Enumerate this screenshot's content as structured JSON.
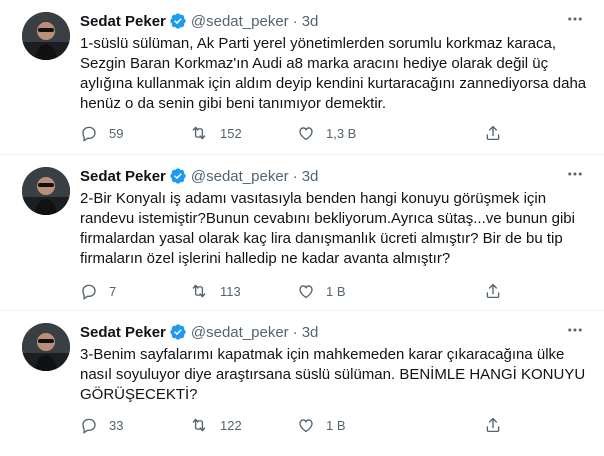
{
  "tweets": [
    {
      "name": "Sedat Peker",
      "handle": "@sedat_peker",
      "separator": "·",
      "time": "3d",
      "text": "1-süslü sülüman, Ak Parti yerel yönetimlerden sorumlu korkmaz karaca,\nSezgin Baran Korkmaz'ın Audi a8 marka aracını hediye olarak değil üç\naylığına kullanmak için aldım deyip kendini kurtaracağını zannediyorsa daha\nhenüz o da senin gibi beni tanımıyor demektir.",
      "replies": "59",
      "retweets": "152",
      "likes": "1,3 B"
    },
    {
      "name": "Sedat Peker",
      "handle": "@sedat_peker",
      "separator": "·",
      "time": "3d",
      "text": "2-Bir Konyalı iş adamı vasıtasıyla benden hangi konuyu görüşmek için\nrandevu istemiştir?Bunun cevabını bekliyorum.Ayrıca sütaş...ve bunun gibi\nfirmalardan yasal olarak kaç lira danışmanlık ücreti almıştır? Bir de bu tip\nfirmaların özel işlerini halledip ne kadar avanta almıştır?",
      "replies": "7",
      "retweets": "113",
      "likes": "1 B"
    },
    {
      "name": "Sedat Peker",
      "handle": "@sedat_peker",
      "separator": "·",
      "time": "3d",
      "text": "3-Benim sayfalarımı kapatmak için mahkemeden karar çıkaracağına ülke\nnasıl soyuluyor diye araştırsana süslü sülüman. BENİMLE HANGİ KONUYU\nGÖRÜŞECEKTİ?",
      "replies": "33",
      "retweets": "122",
      "likes": "1 B"
    }
  ],
  "colors": {
    "text": "#0f1419",
    "muted": "#536471",
    "verified": "#1d9bf0",
    "divider": "#eff3f4"
  },
  "icons": [
    "verified-badge-icon",
    "more-icon",
    "reply-icon",
    "retweet-icon",
    "like-icon",
    "share-icon"
  ]
}
